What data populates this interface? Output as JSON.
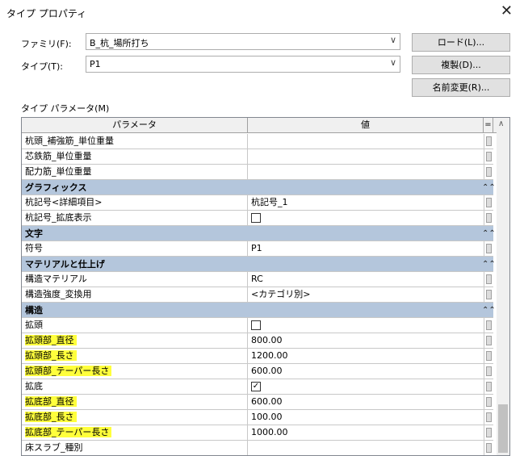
{
  "window": {
    "title": "タイプ プロパティ",
    "close_glyph": "✕"
  },
  "family": {
    "label": "ファミリ(F):",
    "value": "B_杭_場所打ち"
  },
  "type": {
    "label": "タイプ(T):",
    "value": "P1"
  },
  "buttons": {
    "load": "ロード(L)...",
    "duplicate": "複製(D)...",
    "rename": "名前変更(R)..."
  },
  "params_label": "タイプ パラメータ(M)",
  "grid": {
    "col_param": "パラメータ",
    "col_value": "値",
    "col_eq": "=",
    "rows": [
      {
        "kind": "row",
        "name": "杭頭_補強筋_単位重量",
        "value": ""
      },
      {
        "kind": "row",
        "name": "芯鉄筋_単位重量",
        "value": ""
      },
      {
        "kind": "row",
        "name": "配力筋_単位重量",
        "value": ""
      },
      {
        "kind": "group",
        "name": "グラフィックス"
      },
      {
        "kind": "row",
        "name": "杭記号<詳細項目>",
        "value": "杭記号_1"
      },
      {
        "kind": "row",
        "name": "杭記号_拡底表示",
        "value": "",
        "checkbox": false
      },
      {
        "kind": "group",
        "name": "文字"
      },
      {
        "kind": "row",
        "name": "符号",
        "value": "P1"
      },
      {
        "kind": "group",
        "name": "マテリアルと仕上げ"
      },
      {
        "kind": "row",
        "name": "構造マテリアル",
        "value": "RC"
      },
      {
        "kind": "row",
        "name": "構造強度_変換用",
        "value": "<カテゴリ別>"
      },
      {
        "kind": "group",
        "name": "構造"
      },
      {
        "kind": "row",
        "name": "拡頭",
        "value": "",
        "checkbox": false
      },
      {
        "kind": "row",
        "name": "拡頭部_直径",
        "value": "800.00",
        "highlight": true
      },
      {
        "kind": "row",
        "name": "拡頭部_長さ",
        "value": "1200.00",
        "highlight": true
      },
      {
        "kind": "row",
        "name": "拡頭部_テーパー長さ",
        "value": "600.00",
        "highlight": true
      },
      {
        "kind": "row",
        "name": "拡底",
        "value": "",
        "checkbox": true
      },
      {
        "kind": "row",
        "name": "拡底部_直径",
        "value": "600.00",
        "highlight": true
      },
      {
        "kind": "row",
        "name": "拡底部_長さ",
        "value": "100.00",
        "highlight": true
      },
      {
        "kind": "row",
        "name": "拡底部_テーパー長さ",
        "value": "1000.00",
        "highlight": true
      },
      {
        "kind": "row",
        "name": "床スラブ_種別",
        "value": ""
      }
    ]
  },
  "icons": {
    "collapse": "chevrons-up-icon",
    "dropdown": "chevron-down-icon",
    "scroll_up": "scroll-up-icon"
  }
}
